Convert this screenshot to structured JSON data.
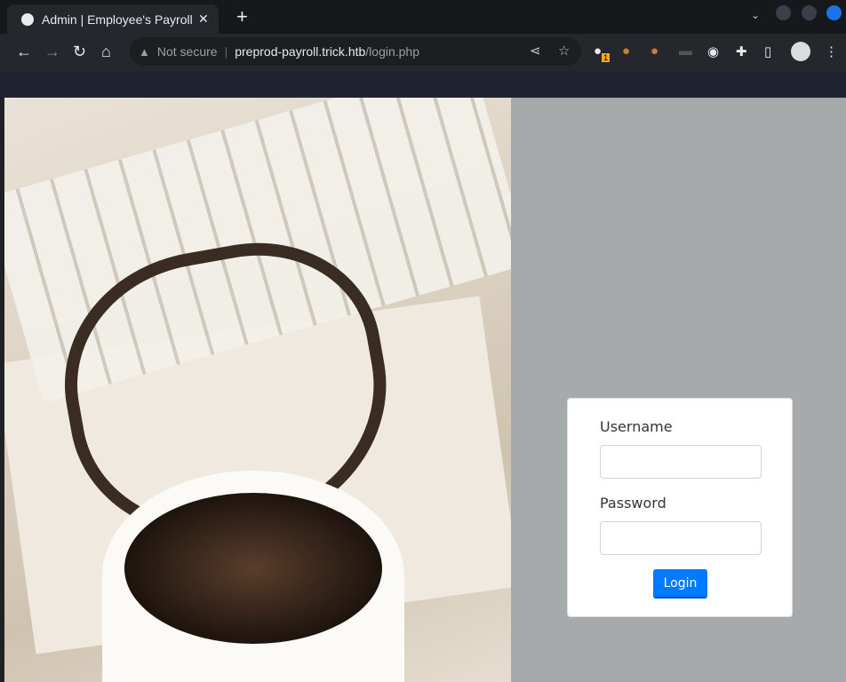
{
  "browser": {
    "tab_title": "Admin | Employee's Payroll Management System",
    "new_tab": "+",
    "address": {
      "security": "Not secure",
      "host": "preprod-payroll.trick.htb",
      "path": "/login.php"
    },
    "extension_badge": "1"
  },
  "login": {
    "username_label": "Username",
    "password_label": "Password",
    "username_value": "",
    "password_value": "",
    "login_label": "Login"
  },
  "colors": {
    "accent": "#007bff",
    "page_bg": "#a7aaad"
  }
}
